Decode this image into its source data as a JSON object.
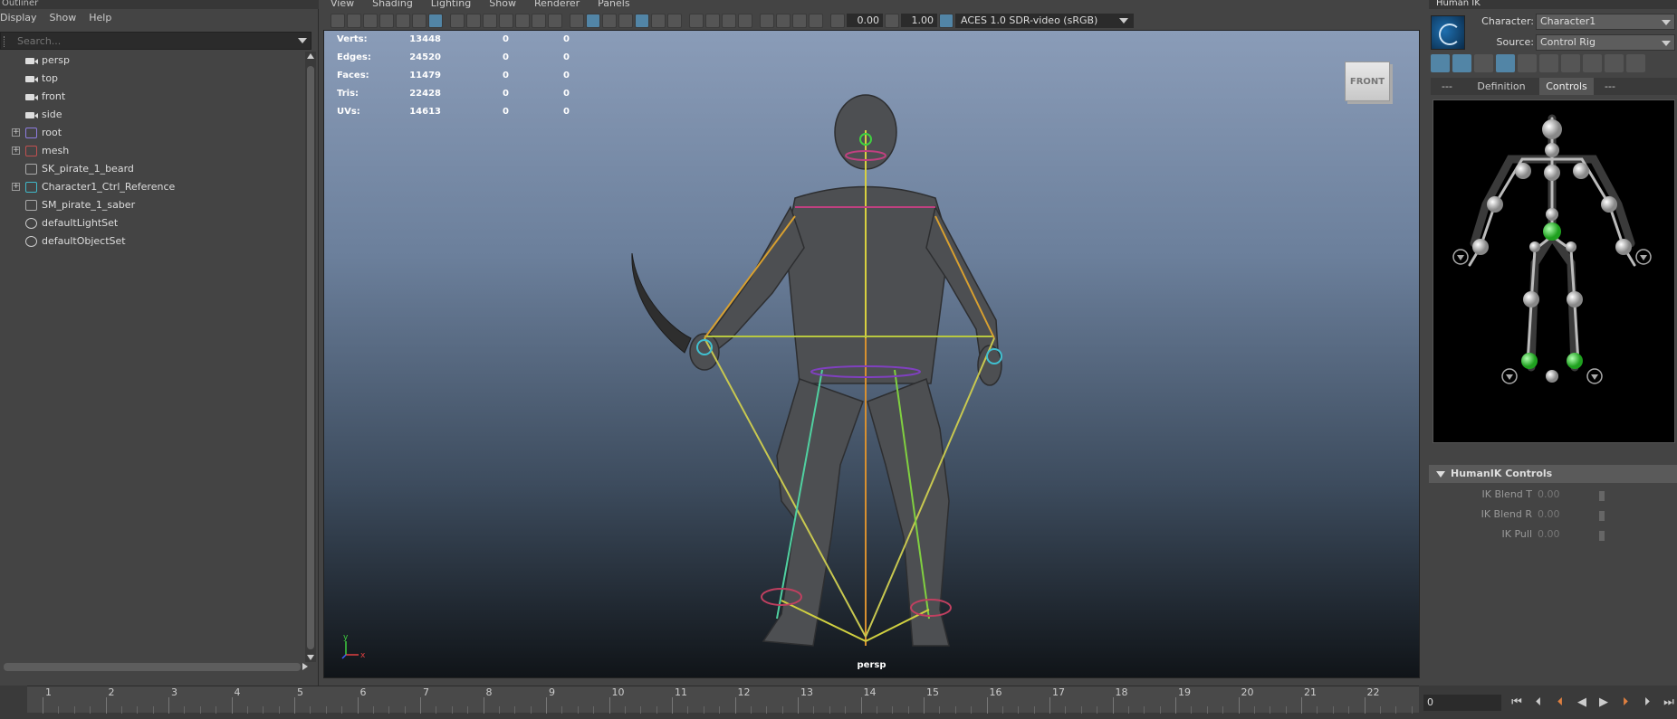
{
  "outliner": {
    "title": "Outliner",
    "menu": [
      "Display",
      "Show",
      "Help"
    ],
    "search_placeholder": "Search...",
    "items": [
      {
        "label": "persp",
        "icon": "camera-icon",
        "expandable": false
      },
      {
        "label": "top",
        "icon": "camera-icon",
        "expandable": false
      },
      {
        "label": "front",
        "icon": "camera-icon",
        "expandable": false
      },
      {
        "label": "side",
        "icon": "camera-icon",
        "expandable": false
      },
      {
        "label": "root",
        "icon": "joint-icon",
        "expandable": true
      },
      {
        "label": "mesh",
        "icon": "mesh-icon",
        "expandable": true
      },
      {
        "label": "SK_pirate_1_beard",
        "icon": "transform-icon",
        "expandable": false
      },
      {
        "label": "Character1_Ctrl_Reference",
        "icon": "hik-reference-icon",
        "expandable": true
      },
      {
        "label": "SM_pirate_1_saber",
        "icon": "transform-icon",
        "expandable": false
      },
      {
        "label": "defaultLightSet",
        "icon": "set-icon",
        "expandable": false
      },
      {
        "label": "defaultObjectSet",
        "icon": "set-icon",
        "expandable": false
      }
    ]
  },
  "viewport": {
    "menu": [
      "View",
      "Shading",
      "Lighting",
      "Show",
      "Renderer",
      "Panels"
    ],
    "exposure": "0.00",
    "gamma": "1.00",
    "color_space": "ACES 1.0 SDR-video (sRGB)",
    "camera_label": "persp",
    "view_cube": "FRONT",
    "hud": [
      {
        "label": "Verts:",
        "v1": "13448",
        "v2": "0",
        "v3": "0"
      },
      {
        "label": "Edges:",
        "v1": "24520",
        "v2": "0",
        "v3": "0"
      },
      {
        "label": "Faces:",
        "v1": "11479",
        "v2": "0",
        "v3": "0"
      },
      {
        "label": "Tris:",
        "v1": "22428",
        "v2": "0",
        "v3": "0"
      },
      {
        "label": "UVs:",
        "v1": "14613",
        "v2": "0",
        "v3": "0"
      }
    ],
    "axis": {
      "x": "x",
      "y": "y"
    }
  },
  "humanik": {
    "title": "Human IK",
    "character_label": "Character:",
    "character_value": "Character1",
    "source_label": "Source:",
    "source_value": "Control Rig",
    "tabs": [
      "---",
      "Definition",
      "Controls",
      "---"
    ],
    "active_tab": "Controls",
    "controls_header": "HumanIK Controls",
    "params": [
      {
        "label": "IK Blend T",
        "value": "0.00"
      },
      {
        "label": "IK Blend R",
        "value": "0.00"
      },
      {
        "label": "IK Pull",
        "value": "0.00"
      }
    ]
  },
  "timeline": {
    "ticks": [
      "1",
      "2",
      "3",
      "4",
      "5",
      "6",
      "7",
      "8",
      "9",
      "10",
      "11",
      "12",
      "13",
      "14",
      "15",
      "16",
      "17",
      "18",
      "19",
      "20",
      "21",
      "22"
    ],
    "current_frame": "0"
  },
  "colors": {
    "accent": "#5285a6",
    "panel": "#444444",
    "viewport_top": "#8a9cb8",
    "viewport_bottom": "#101418"
  }
}
